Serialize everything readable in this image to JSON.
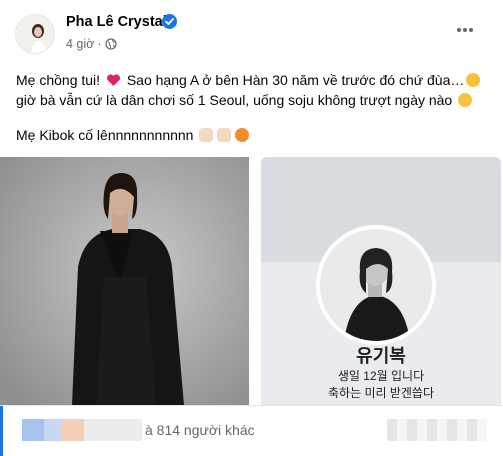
{
  "post": {
    "author": "Pha Lê Crystal",
    "time": "4 giờ",
    "dot": "·",
    "text_line1": "Mẹ chồng tui! ",
    "text_line1b": " Sao hạng A ở bên Hàn 30 năm về trước đó chứ đùa…",
    "text_line1c": " giờ bà vẫn cứ là dân chơi số 1 Seoul, uống soju không trượt ngày nào ",
    "text_line2": "Mẹ Kibok cố lênnnnnnnnnnn "
  },
  "card": {
    "name": "유기복",
    "line1": "생일 12월 입니다",
    "line2": "축하는 미리 받겐씁다"
  },
  "reactions": {
    "label": "à 814 người khác"
  },
  "colors": {
    "accent": "#1b74e4",
    "heart": "#e0245e",
    "emoji_yellow": "#f7c23a"
  },
  "icons": [
    "verified-badge-icon",
    "globe-icon",
    "more-options-icon",
    "heart-emoji",
    "smile-emoji",
    "laughing-emoji",
    "muscle-emoji",
    "peace-emoji",
    "spark-emoji"
  ]
}
